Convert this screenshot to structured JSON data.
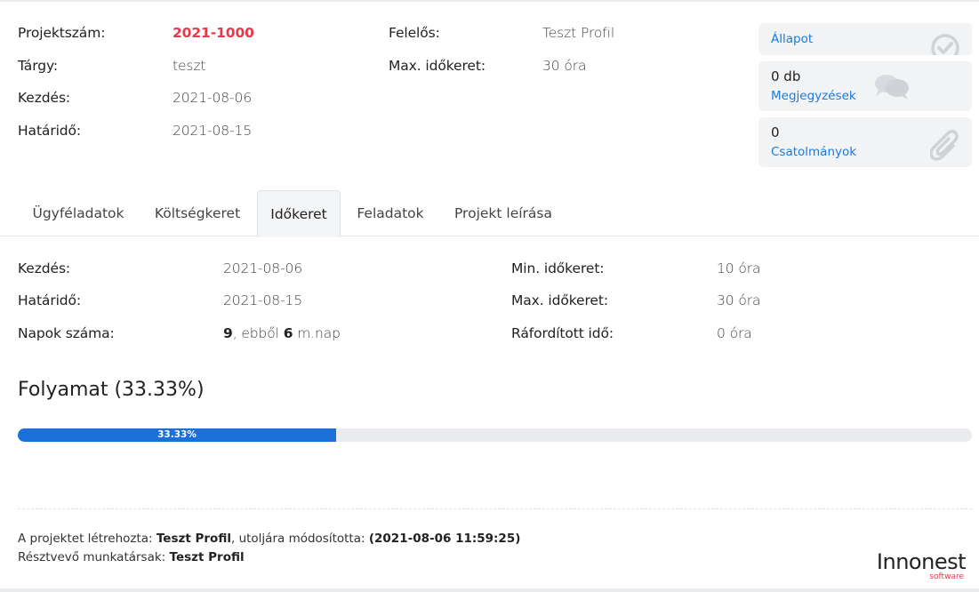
{
  "project": {
    "number_label": "Projektszám:",
    "number_value": "2021-1000",
    "subject_label": "Tárgy:",
    "subject_value": "teszt",
    "start_label": "Kezdés:",
    "start_value": "2021-08-06",
    "deadline_label": "Határidő:",
    "deadline_value": "2021-08-15",
    "owner_label": "Felelős:",
    "owner_value": "Teszt Profil",
    "maxtime_label": "Max. időkeret:",
    "maxtime_value": "30 óra"
  },
  "cards": {
    "status_label": "Állapot",
    "comments_count": "0 db",
    "comments_label": "Megjegyzések",
    "attachments_count": "0",
    "attachments_label": "Csatolmányok"
  },
  "tabs": [
    {
      "label": "Ügyféladatok",
      "active": false
    },
    {
      "label": "Költségkeret",
      "active": false
    },
    {
      "label": "Időkeret",
      "active": true
    },
    {
      "label": "Feladatok",
      "active": false
    },
    {
      "label": "Projekt leírása",
      "active": false
    }
  ],
  "timeframe": {
    "start_label": "Kezdés:",
    "start_value": "2021-08-06",
    "deadline_label": "Határidő:",
    "deadline_value": "2021-08-15",
    "days_label": "Napok száma:",
    "days_total": "9",
    "days_sep": ", ebből ",
    "days_work": "6",
    "days_unit": " m.nap",
    "min_label": "Min. időkeret:",
    "min_value": "10 óra",
    "max_label": "Max. időkeret:",
    "max_value": "30 óra",
    "spent_label": "Ráfordított idő:",
    "spent_value": "0 óra"
  },
  "progress": {
    "title": "Folyamat (33.33%)",
    "bar_label": "33.33%",
    "fraction": 0.3333,
    "color": "#1a6fd9"
  },
  "footer": {
    "created_prefix": "A projektet létrehozta: ",
    "created_by": "Teszt Profil",
    "modified_prefix": ", utoljára módosította: ",
    "modified_at": "(2021-08-06 11:59:25)",
    "participants_prefix": "Résztvevő munkatársak: ",
    "participants": "Teszt Profil"
  },
  "brand": {
    "name": "Innonest",
    "tagline": "software",
    "accent": "#e6394a",
    "link": "#1e7ad9"
  },
  "icons": {
    "status": "check-circle-icon",
    "comments": "comments-icon",
    "attachments": "paperclip-icon"
  }
}
